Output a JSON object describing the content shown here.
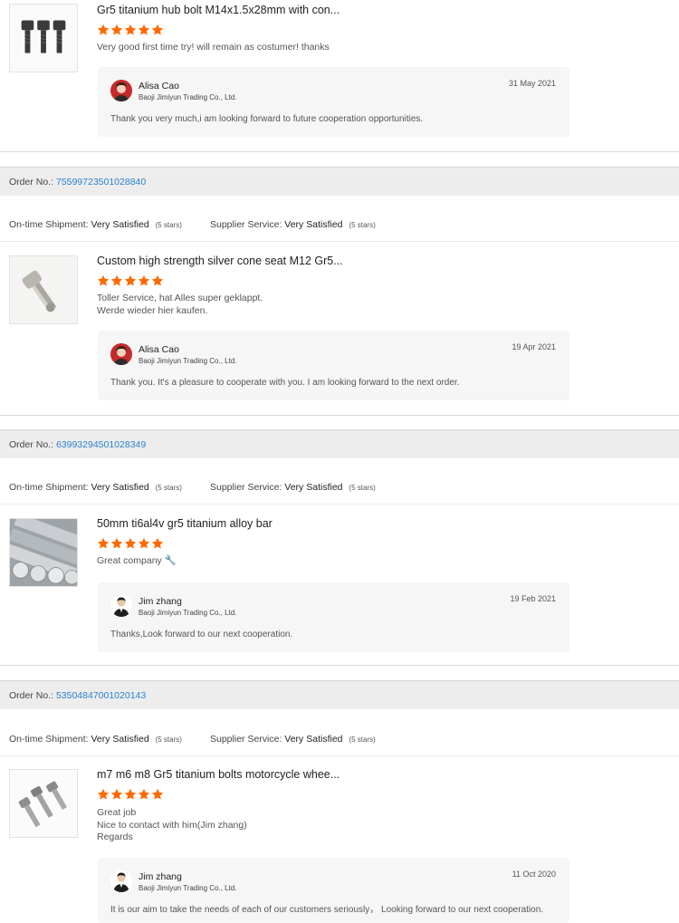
{
  "colors": {
    "star": "#ff6a00",
    "link": "#2c82d0"
  },
  "labels": {
    "order_no": "Order No.:",
    "shipment": "On-time Shipment:",
    "service": "Supplier Service:"
  },
  "reviews": [
    {
      "product": "Gr5 titanium hub bolt M14x1.5x28mm with con...",
      "stars": 5,
      "image": "black-bolts",
      "comment": [
        "Very good first time try! will remain as costumer! thanks"
      ],
      "reply": {
        "name": "Alisa Cao",
        "company": "Baoji Jimiyun Trading Co., Ltd.",
        "date": "31 May 2021",
        "text": "Thank you very much,i am looking forward to future cooperation opportunities.",
        "avatar": "female-avatar"
      }
    },
    {
      "order_no": "75599723501028840",
      "shipment": "Very Satisfied",
      "shipment_note": "(5 stars)",
      "service": "Very Satisfied",
      "service_note": "(5 stars)",
      "product": "Custom high strength silver cone seat M12 Gr5...",
      "stars": 5,
      "image": "silver-bolt",
      "comment": [
        "Toller Service, hat Alles super geklappt.",
        "Werde wieder hier kaufen."
      ],
      "reply": {
        "name": "Alisa Cao",
        "company": "Baoji Jimiyun Trading Co., Ltd.",
        "date": "19 Apr 2021",
        "text": "Thank you. It's a pleasure to cooperate with you. I am looking forward to the next order.",
        "avatar": "female-avatar"
      }
    },
    {
      "order_no": "63993294501028349",
      "shipment": "Very Satisfied",
      "shipment_note": "(5 stars)",
      "service": "Very Satisfied",
      "service_note": "(5 stars)",
      "product": "50mm ti6al4v gr5 titanium alloy bar",
      "stars": 5,
      "image": "titanium-bars",
      "comment": [
        "Great company 🔧"
      ],
      "reply": {
        "name": "Jim zhang",
        "company": "Baoji Jimiyun Trading Co., Ltd.",
        "date": "19 Feb 2021",
        "text": "Thanks,Look forward to our next cooperation.",
        "avatar": "male-avatar"
      }
    },
    {
      "order_no": "53504847001020143",
      "shipment": "Very Satisfied",
      "shipment_note": "(5 stars)",
      "service": "Very Satisfied",
      "service_note": "(5 stars)",
      "product": "m7 m6 m8 Gr5 titanium bolts motorcycle whee...",
      "stars": 5,
      "image": "silver-bolts",
      "comment": [
        "Great job",
        "Nice to contact with him(Jim zhang)",
        "Regards"
      ],
      "reply": {
        "name": "Jim zhang",
        "company": "Baoji Jimiyun Trading Co., Ltd.",
        "date": "11 Oct 2020",
        "text": "It is our aim to take the needs of each of our customers seriously， Looking forward to our next cooperation.",
        "avatar": "male-avatar"
      }
    }
  ]
}
